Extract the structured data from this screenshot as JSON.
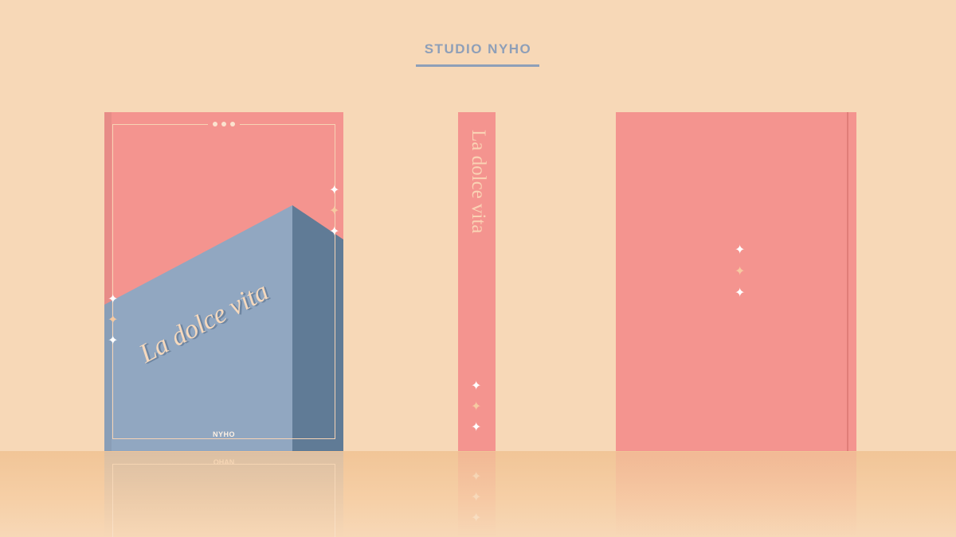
{
  "header": {
    "brand": "STUDIO NYHO"
  },
  "front_cover": {
    "title": "La dolce vita",
    "author_label": "NYHO",
    "colors": {
      "top": "#f4948f",
      "building_face": "#91a7c1",
      "building_side": "#607b96"
    }
  },
  "spine": {
    "title": "La dolce vita"
  },
  "reflection": {
    "mirrored_label": "OHAN"
  },
  "colors": {
    "background": "#f7d8b7",
    "brand_text": "#8e9fb8",
    "cover": "#f4948f"
  },
  "icons": [
    "sparkle-star-icon",
    "dot-icon"
  ]
}
